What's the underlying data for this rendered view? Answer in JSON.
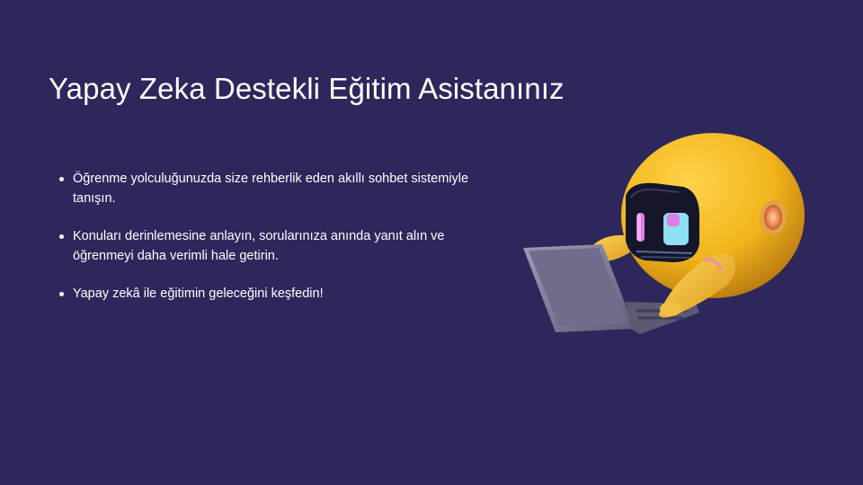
{
  "slide": {
    "title": "Yapay Zeka Destekli Eğitim Asistanınız",
    "bullets": [
      "Öğrenme yolculuğunuzda size rehberlik eden akıllı sohbet sistemiyle tanışın.",
      "Konuları derinlemesine anlayın, sorularınıza anında yanıt alın ve öğrenmeyi daha verimli hale getirin.",
      "Yapay zekâ ile eğitimin geleceğini keşfedin!"
    ]
  },
  "colors": {
    "background": "#2e275c",
    "text": "#ffffff",
    "robot_body": "#f2b51c",
    "robot_visor": "#15162a",
    "eye_pink": "#e07ce8",
    "eye_cyan": "#8fe0f0",
    "laptop": "#8a8aa6"
  },
  "illustration": {
    "icon": "robot-with-laptop-icon"
  }
}
